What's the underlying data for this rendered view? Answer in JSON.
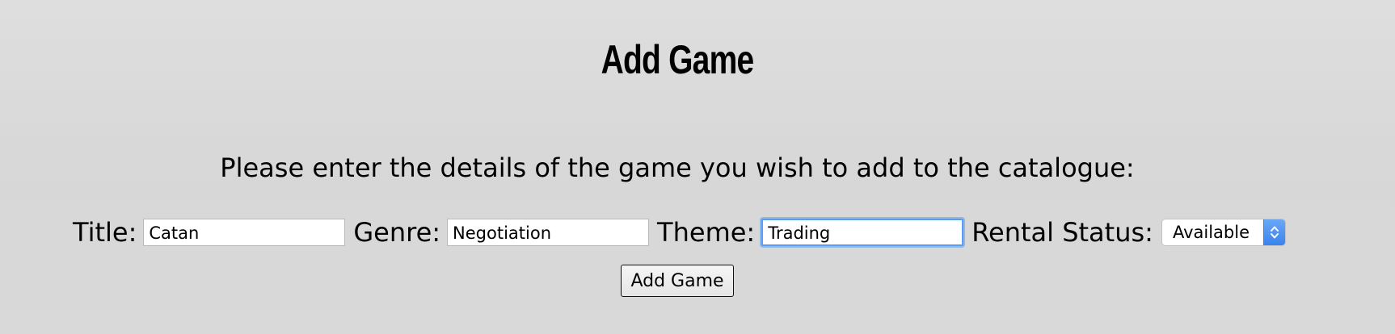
{
  "header": {
    "title": "Add Game"
  },
  "instructions": "Please enter the details of the game you wish to add to the catalogue:",
  "form": {
    "title_label": "Title:",
    "title_value": "Catan",
    "genre_label": "Genre:",
    "genre_value": "Negotiation",
    "theme_label": "Theme:",
    "theme_value": "Trading",
    "rental_status_label": "Rental Status:",
    "rental_status_value": "Available",
    "submit_label": "Add Game"
  },
  "colors": {
    "background": "#d9d9d9",
    "focus_ring": "#5b9df0",
    "select_accent": "#3a83ee"
  },
  "icons": {
    "select_arrows": "chevron-up-down-icon"
  }
}
